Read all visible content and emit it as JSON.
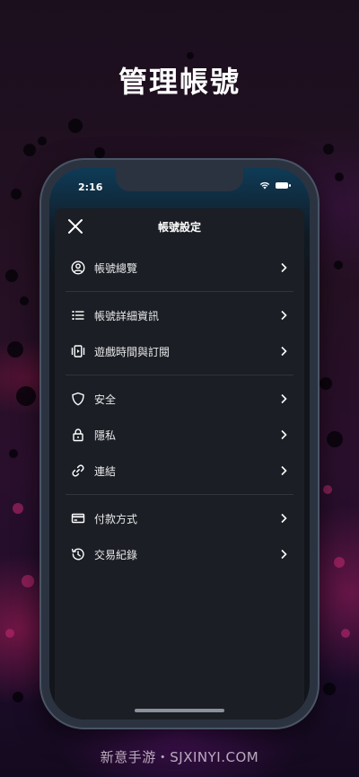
{
  "page_title": "管理帳號",
  "status_bar": {
    "time": "2:16",
    "icons": [
      "wifi-icon",
      "battery-icon"
    ]
  },
  "sheet": {
    "title": "帳號設定",
    "close_icon": "close-icon",
    "sections": [
      {
        "items": [
          {
            "label": "帳號總覽",
            "icon": "account-circle-icon"
          }
        ]
      },
      {
        "items": [
          {
            "label": "帳號詳細資訊",
            "icon": "list-icon"
          },
          {
            "label": "遊戲時間與訂閱",
            "icon": "subscription-icon"
          }
        ]
      },
      {
        "items": [
          {
            "label": "安全",
            "icon": "shield-icon"
          },
          {
            "label": "隱私",
            "icon": "lock-icon"
          },
          {
            "label": "連結",
            "icon": "link-icon"
          }
        ]
      },
      {
        "items": [
          {
            "label": "付款方式",
            "icon": "credit-card-icon"
          },
          {
            "label": "交易紀錄",
            "icon": "history-icon"
          }
        ]
      }
    ]
  },
  "watermark": "新意手游・SJXINYI.COM",
  "colors": {
    "sheet_bg": "#1b1e24",
    "text": "#e9eaec",
    "divider": "#30343b"
  }
}
